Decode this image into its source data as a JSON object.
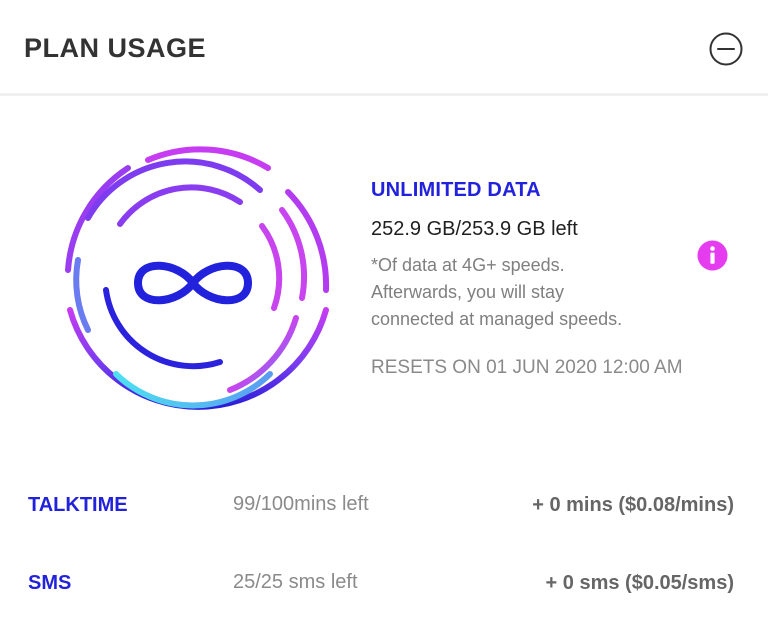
{
  "header": {
    "title": "PLAN USAGE",
    "collapse_icon": "minus-circle-icon"
  },
  "data_plan": {
    "ring_icon": "infinity-icon",
    "title": "UNLIMITED DATA",
    "remaining": "252.9 GB/253.9 GB left",
    "note_line1": "*Of data at 4G+ speeds.",
    "note_line2": "Afterwards, you will stay",
    "note_line3": "connected at managed speeds.",
    "reset": "RESETS ON 01 JUN 2020 12:00 AM",
    "info_icon": "info-icon"
  },
  "usage": [
    {
      "label": "TALKTIME",
      "value": "99/100mins left",
      "topup": "+ 0 mins ($0.08/mins)"
    },
    {
      "label": "SMS",
      "value": "25/25 sms left",
      "topup": "+ 0 sms ($0.05/sms)"
    }
  ],
  "colors": {
    "accent_blue": "#2222dd",
    "info_pink": "#e63cf0",
    "ring_purple": "#b43cf0",
    "ring_cyan": "#5ce3f0"
  }
}
